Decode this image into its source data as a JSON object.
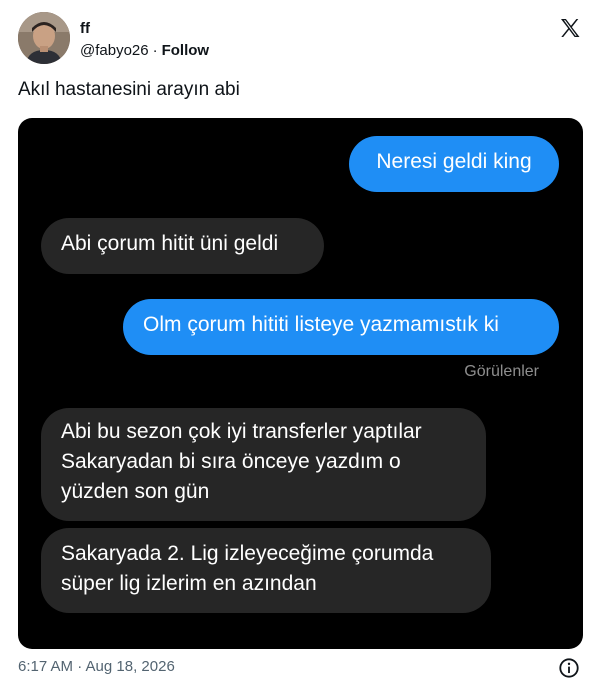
{
  "author": {
    "name": "ff",
    "handle": "@fabyo26",
    "separator": "·",
    "follow_label": "Follow"
  },
  "tweet": {
    "text": "Akıl hastanesini arayın abi"
  },
  "chat": {
    "messages": [
      {
        "direction": "outgoing",
        "lines": [
          "Neresi geldi king"
        ]
      },
      {
        "direction": "incoming",
        "lines": [
          "Abi çorum hitit üni geldi"
        ]
      },
      {
        "direction": "outgoing",
        "lines": [
          "Olm çorum hititi listeye yazmamıstık ki"
        ]
      },
      {
        "direction": "incoming",
        "lines": [
          "Abi bu sezon çok iyi transferler yaptılar",
          "Sakaryadan bi sıra önceye yazdım o",
          "yüzden son gün"
        ]
      },
      {
        "direction": "incoming",
        "lines": [
          "Sakaryada 2. Lig izleyeceğime çorumda",
          "süper lig izlerim en azından"
        ]
      }
    ],
    "seen_label": "Görülenler"
  },
  "footer": {
    "timestamp": "6:17 AM · Aug 18, 2026"
  },
  "colors": {
    "outgoing_bubble": "#1f8ef5",
    "incoming_bubble": "#262626",
    "media_background": "#000000"
  },
  "icons": {
    "brand": "x-logo-icon",
    "info": "info-icon"
  }
}
